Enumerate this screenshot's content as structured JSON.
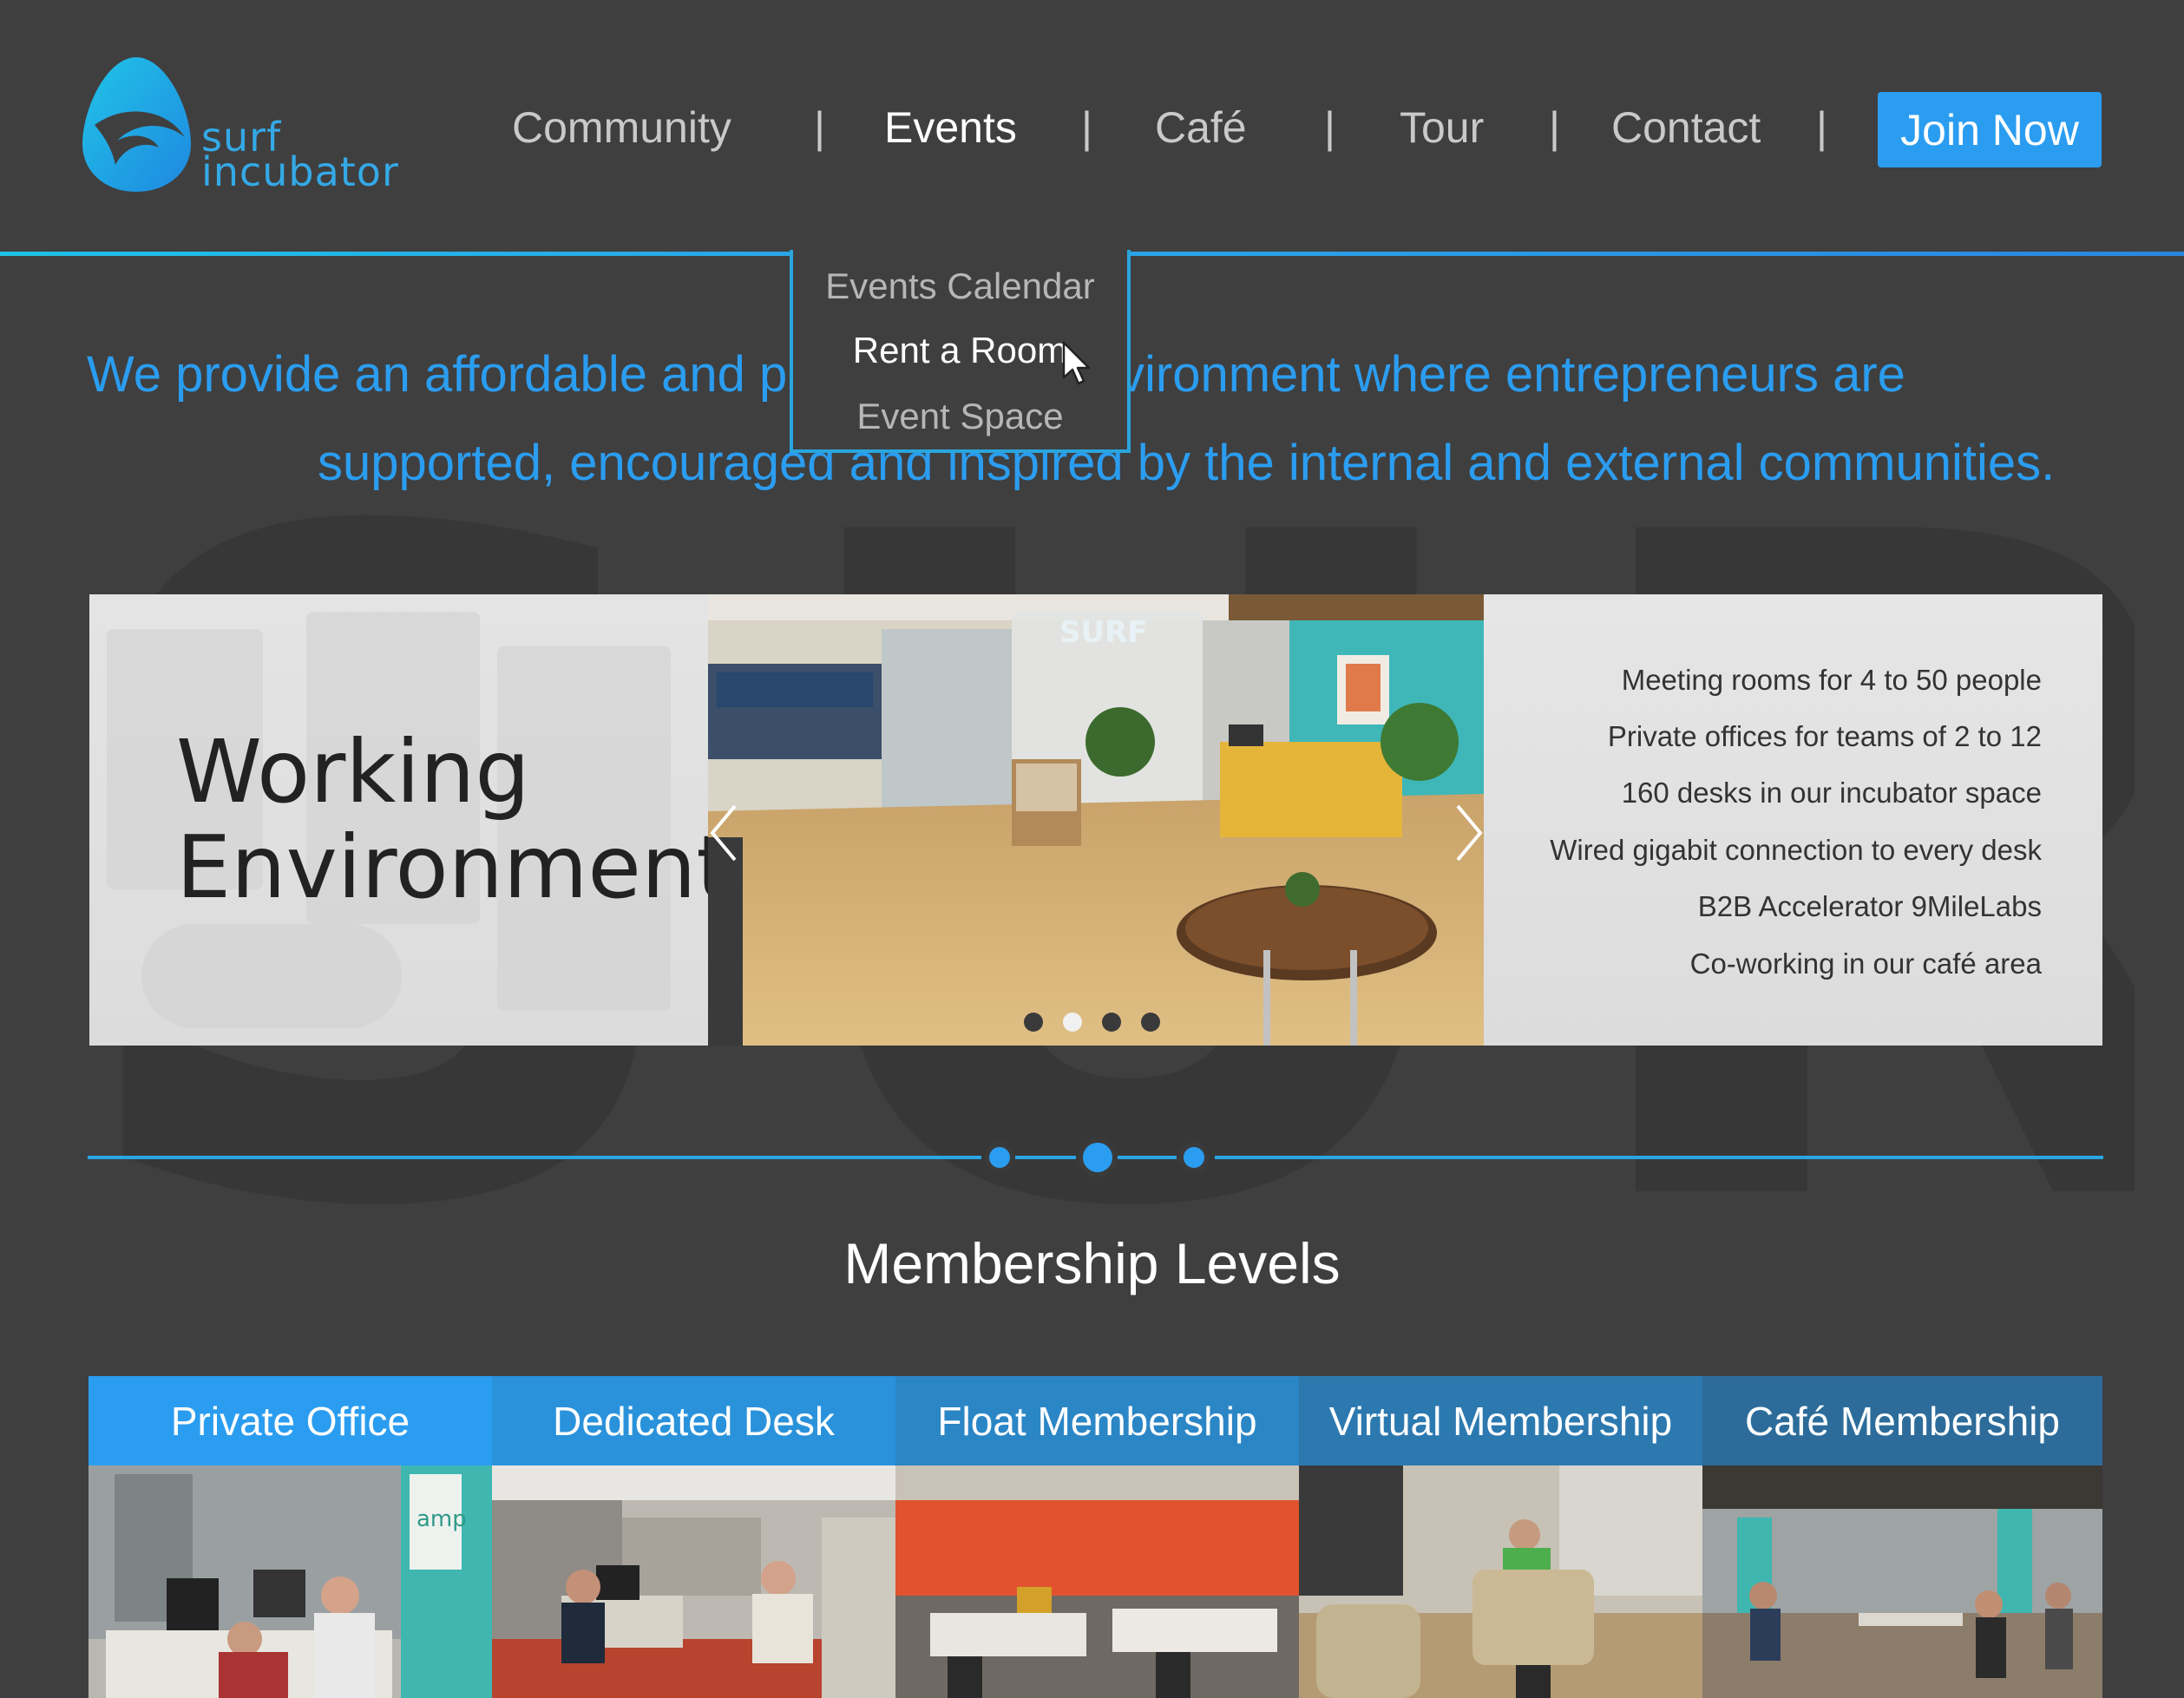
{
  "brand": {
    "line1": "surf",
    "line2": "incubator",
    "accent": "#2b9df0"
  },
  "nav": {
    "items": [
      "Community",
      "Events",
      "Café",
      "Tour",
      "Contact"
    ],
    "separator": "|",
    "active": "Events",
    "join_label": "Join Now"
  },
  "dropdown": {
    "items": [
      "Events Calendar",
      "Rent a Room",
      "Event Space"
    ],
    "hover": "Rent a Room"
  },
  "mission": {
    "line1_left": "We provide an affordable and p",
    "line1_right": "vironment where entrepreneurs are",
    "line2_left": "supported, encouraged and inspired by the internal and external communities."
  },
  "carousel": {
    "title_line1": "Working",
    "title_line2": "Environment",
    "features": [
      "Meeting rooms for 4 to 50 people",
      "Private offices for teams of 2 to 12",
      "160 desks in our incubator space",
      "Wired gigabit connection to every desk",
      "B2B Accelerator 9MileLabs",
      "Co-working in our café area"
    ],
    "slide_count": 4,
    "active_slide": 2,
    "photo_sign": "SURF"
  },
  "membership": {
    "title": "Membership Levels",
    "tabs": [
      {
        "label": "Private Office",
        "color": "#2b9df0"
      },
      {
        "label": "Dedicated Desk",
        "color": "#2a92db"
      },
      {
        "label": "Float Membership",
        "color": "#2b86c6"
      },
      {
        "label": "Virtual Membership",
        "color": "#2c79b0"
      },
      {
        "label": "Café Membership",
        "color": "#2d6c9a"
      }
    ],
    "sign_text": "amp"
  }
}
